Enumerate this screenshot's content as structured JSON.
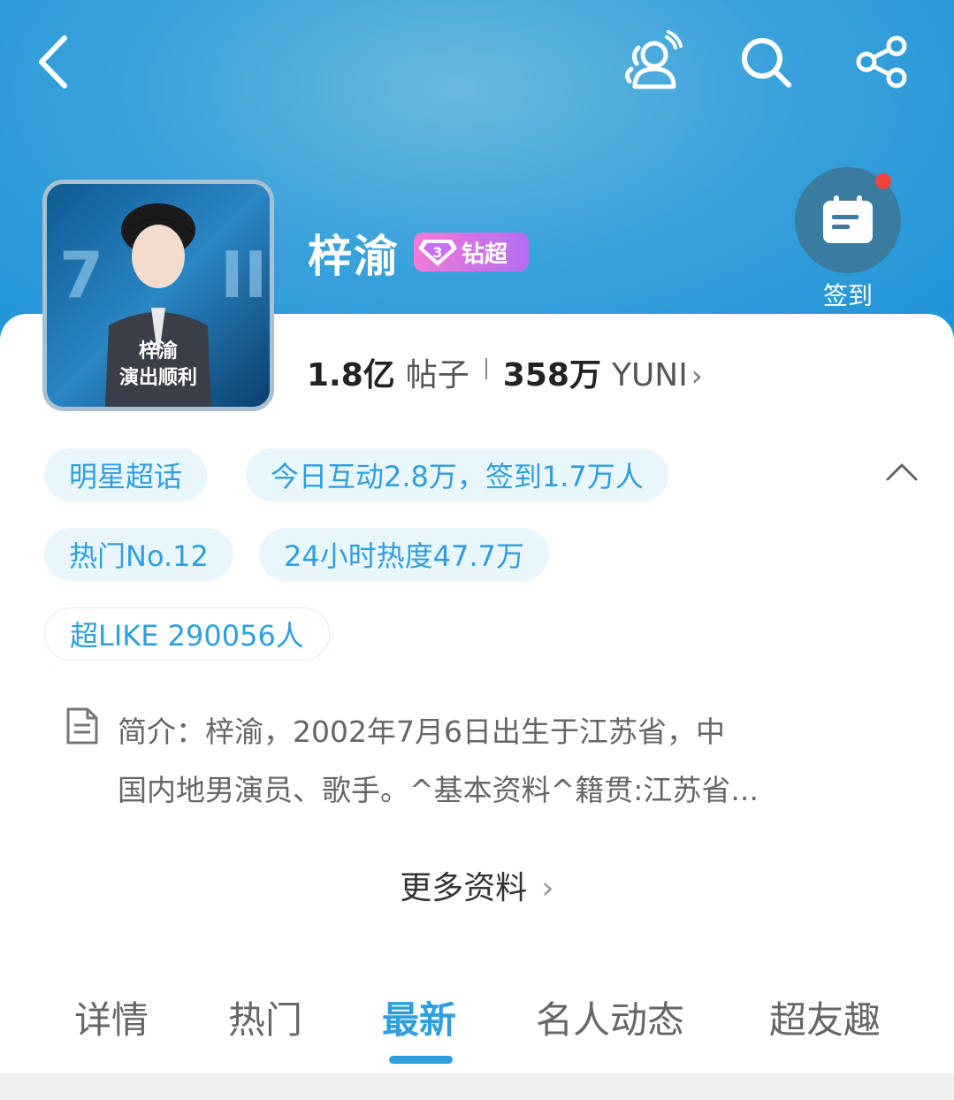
{
  "header": {
    "name": "梓渝",
    "badge_label": "钻超",
    "badge_level": "3",
    "checkin_label": "签到"
  },
  "avatar": {
    "caption_line1": "梓渝",
    "caption_line2": "演出顺利"
  },
  "stats": {
    "posts_count": "1.8亿",
    "posts_label": "帖子",
    "fans_count": "358万",
    "fans_label": "YUNI",
    "chevron": "›"
  },
  "tags": {
    "category": "明星超话",
    "today": "今日互动2.8万，签到1.7万人",
    "hot_rank": "热门No.12",
    "heat_24h": "24小时热度47.7万",
    "super_like": "超LIKE 290056人"
  },
  "intro": {
    "line1": "简介：梓渝，2002年7月6日出生于江苏省，中",
    "line2": "国内地男演员、歌手。^基本资料^籍贯:江苏省..."
  },
  "more": {
    "label": "更多资料",
    "chevron": "›"
  },
  "tabs": [
    {
      "label": "详情"
    },
    {
      "label": "热门"
    },
    {
      "label": "最新"
    },
    {
      "label": "名人动态"
    },
    {
      "label": "超友趣"
    }
  ],
  "active_tab": "最新",
  "colors": {
    "accent": "#2d9fe0",
    "header_bg": "#2a9ad9",
    "badge_gradient_start": "#f27bd8",
    "badge_gradient_end": "#b56df0",
    "notification_dot": "#f0433c"
  },
  "icons": {
    "back": "chevron-left-icon",
    "friends": "users-icon",
    "search": "search-icon",
    "share": "share-icon",
    "checkin": "calendar-icon",
    "intro": "document-icon",
    "collapse": "chevron-up-icon"
  }
}
